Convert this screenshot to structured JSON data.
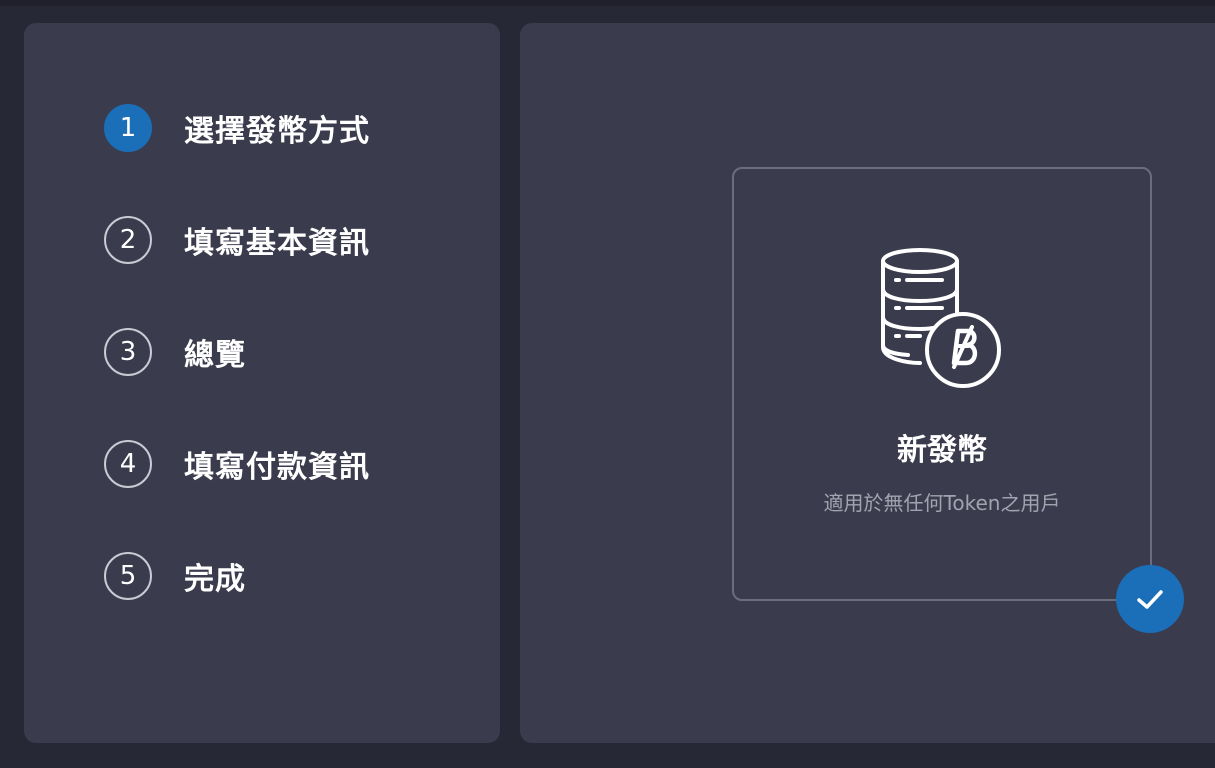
{
  "steps": [
    {
      "number": "1",
      "label": "選擇發幣方式",
      "active": true
    },
    {
      "number": "2",
      "label": "填寫基本資訊",
      "active": false
    },
    {
      "number": "3",
      "label": "總覽",
      "active": false
    },
    {
      "number": "4",
      "label": "填寫付款資訊",
      "active": false
    },
    {
      "number": "5",
      "label": "完成",
      "active": false
    }
  ],
  "option": {
    "title": "新發幣",
    "description": "適用於無任何Token之用戶",
    "icon": "database-coin-icon",
    "selected": true
  },
  "colors": {
    "accent": "#1b6fb8",
    "panel": "#3a3b4d",
    "background": "#272835"
  }
}
